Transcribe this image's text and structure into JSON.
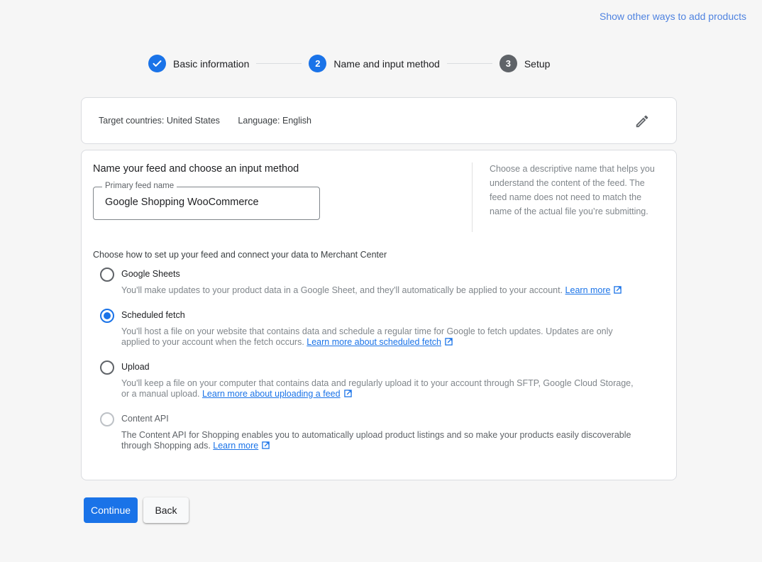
{
  "header": {
    "other_ways_link": "Show other ways to add products"
  },
  "stepper": {
    "steps": [
      {
        "label": "Basic information",
        "state": "done",
        "number": ""
      },
      {
        "label": "Name and input method",
        "state": "active",
        "number": "2"
      },
      {
        "label": "Setup",
        "state": "pending",
        "number": "3"
      }
    ]
  },
  "summary": {
    "target_countries": "Target countries: United States",
    "language": "Language: English",
    "edit_icon": "pencil-icon"
  },
  "feed": {
    "section_title": "Name your feed and choose an input method",
    "field_label": "Primary feed name",
    "field_value": "Google Shopping WooCommerce",
    "help_text": "Choose a descriptive name that helps you understand the content of the feed. The feed name does not need to match the name of the actual file you’re submitting."
  },
  "input_method": {
    "prompt": "Choose how to set up your feed and connect your data to Merchant Center",
    "selected": "Scheduled fetch",
    "options": [
      {
        "title": "Google Sheets",
        "description": "You'll make updates to your product data in a Google Sheet, and they'll automatically be applied to your account.",
        "link": "Learn more",
        "checked": false,
        "disabled": false
      },
      {
        "title": "Scheduled fetch",
        "description": "You'll host a file on your website that contains data and schedule a regular time for Google to fetch updates. Updates are only applied to your account when the fetch occurs.",
        "link": "Learn more about scheduled fetch",
        "checked": true,
        "disabled": false
      },
      {
        "title": "Upload",
        "description": "You'll keep a file on your computer that contains data and regularly upload it to your account through SFTP, Google Cloud Storage, or a manual upload.",
        "link": "Learn more about uploading a feed",
        "checked": false,
        "disabled": false
      },
      {
        "title": "Content API",
        "description": "The Content API for Shopping enables you to automatically upload product listings and so make your products easily discoverable through Shopping ads.",
        "link": "Learn more",
        "checked": false,
        "disabled": true
      }
    ]
  },
  "actions": {
    "continue_label": "Continue",
    "back_label": "Back"
  },
  "colors": {
    "accent": "#1a73e8",
    "link_top": "#4f83e0",
    "background": "#f6f6f6"
  }
}
